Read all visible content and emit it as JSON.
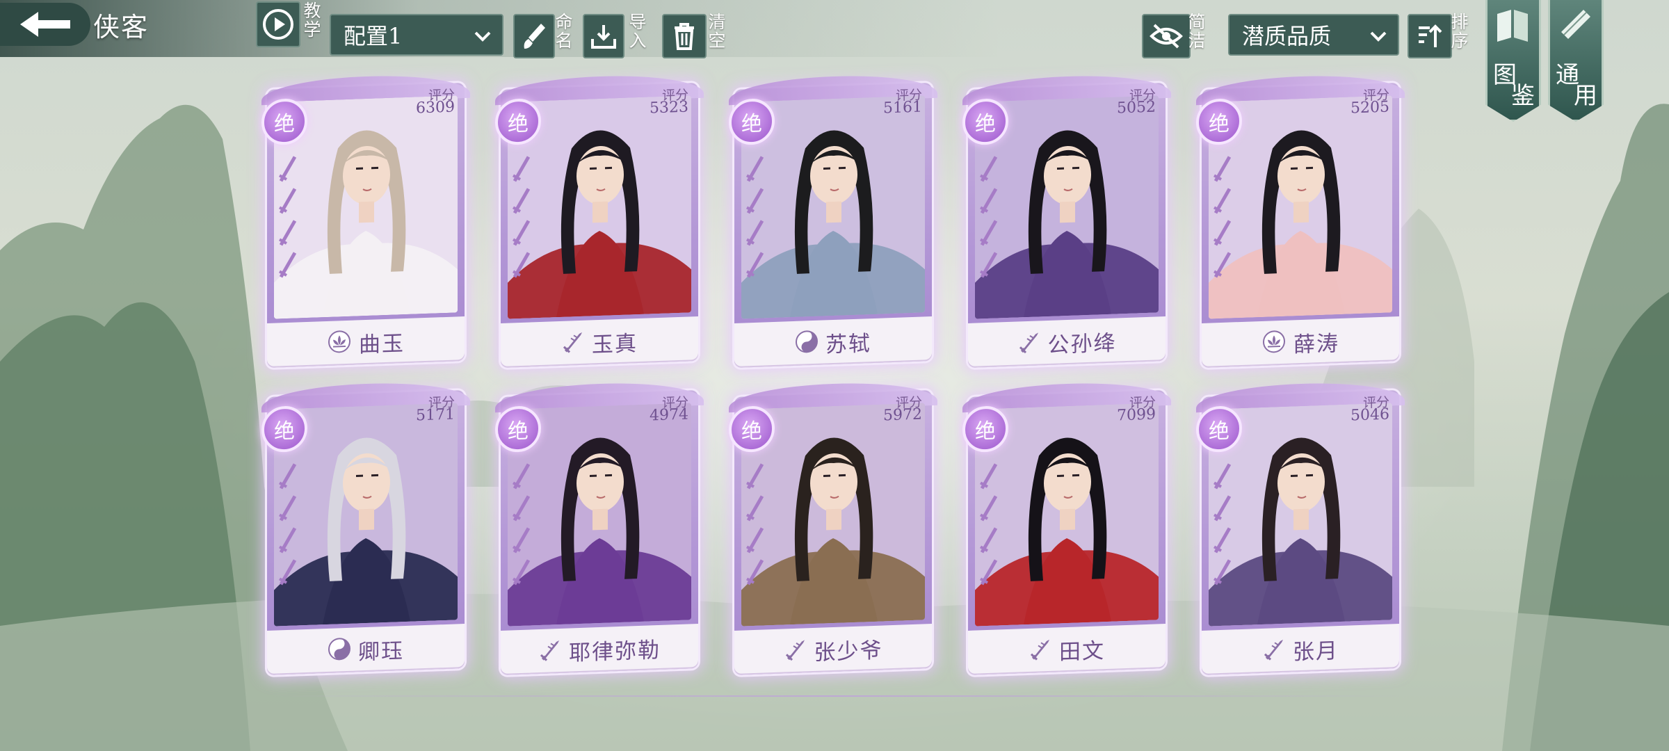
{
  "header": {
    "title": "侠客",
    "tutorial_label": "教学",
    "config_select": "配置1",
    "rename_label": "命名",
    "import_label": "导入",
    "clear_label": "清空",
    "simple_label": "简洁",
    "quality_select": "潜质品质",
    "sort_label": "排序",
    "codex_label_1": "图",
    "codex_label_2": "鉴",
    "common_label_1": "通",
    "common_label_2": "用"
  },
  "card_common": {
    "rank_label": "绝",
    "score_label": "评分"
  },
  "cards": [
    {
      "name": "曲玉",
      "score": "6309",
      "faction_icon": "lotus-icon",
      "bg": "#eae0f0",
      "hair": "#c8b8a8",
      "robe": "#f4f0f4"
    },
    {
      "name": "玉真",
      "score": "5323",
      "faction_icon": "sword-icon",
      "bg": "#d9c9e8",
      "hair": "#1e1a22",
      "robe": "#a8262c"
    },
    {
      "name": "苏轼",
      "score": "5161",
      "faction_icon": "taiji-icon",
      "bg": "#cdbfe0",
      "hair": "#1c1c1e",
      "robe": "#8ea0bd"
    },
    {
      "name": "公孙绛",
      "score": "5052",
      "faction_icon": "sword-icon",
      "bg": "#c5b3dd",
      "hair": "#19161c",
      "robe": "#5a3f86"
    },
    {
      "name": "薛涛",
      "score": "5205",
      "faction_icon": "lotus-icon",
      "bg": "#dccde8",
      "hair": "#1d1a20",
      "robe": "#efc0c0"
    },
    {
      "name": "卿珏",
      "score": "5171",
      "faction_icon": "taiji-icon",
      "bg": "#c9b8dd",
      "hair": "#d8d6e0",
      "robe": "#2b2c52"
    },
    {
      "name": "耶律弥勒",
      "score": "4974",
      "faction_icon": "sword-icon",
      "bg": "#c4acd9",
      "hair": "#231a26",
      "robe": "#6c3c96"
    },
    {
      "name": "张少爷",
      "score": "5972",
      "faction_icon": "sword-icon",
      "bg": "#ccbadb",
      "hair": "#2a221e",
      "robe": "#8a6e52"
    },
    {
      "name": "田文",
      "score": "7099",
      "faction_icon": "sword-icon",
      "bg": "#d0bfe0",
      "hair": "#151218",
      "robe": "#b8262a"
    },
    {
      "name": "张月",
      "score": "5046",
      "faction_icon": "sword-icon",
      "bg": "#d8cae6",
      "hair": "#2a2024",
      "robe": "#5c4a82"
    }
  ]
}
